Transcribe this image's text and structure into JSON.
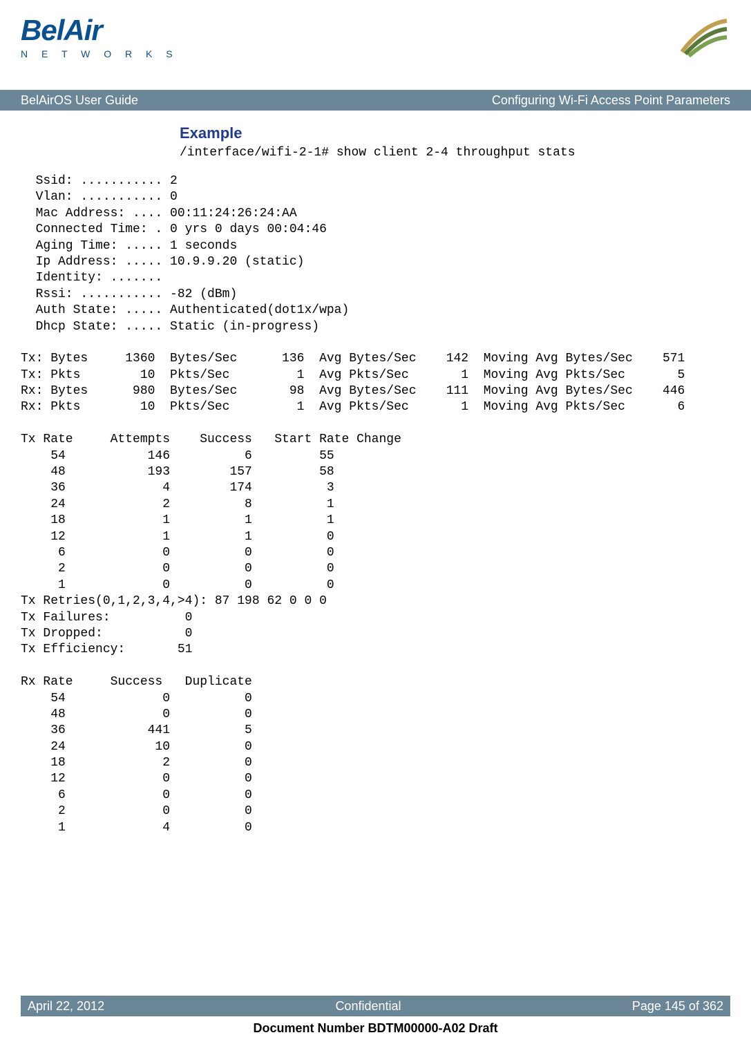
{
  "logo": {
    "brand": "BelAir",
    "subtext": "N E T W O R K S"
  },
  "titlebar": {
    "left": "BelAirOS User Guide",
    "right": "Configuring Wi-Fi Access Point Parameters"
  },
  "section": {
    "heading": "Example",
    "command": "/interface/wifi-2-1# show client 2-4 throughput stats"
  },
  "client_info": {
    "ssid": "2",
    "vlan": "0",
    "mac_address": "00:11:24:26:24:AA",
    "connected_time": "0 yrs 0 days 00:04:46",
    "aging_time": "1 seconds",
    "ip_address": "10.9.9.20 (static)",
    "identity": "",
    "rssi": "-82 (dBm)",
    "auth_state": "Authenticated(dot1x/wpa)",
    "dhcp_state": "Static (in-progress)"
  },
  "throughput": {
    "tx_bytes": {
      "total": "1360",
      "per_sec": "136",
      "avg_per_sec": "142",
      "moving_avg": "571"
    },
    "tx_pkts": {
      "total": "10",
      "per_sec": "1",
      "avg_per_sec": "1",
      "moving_avg": "5"
    },
    "rx_bytes": {
      "total": "980",
      "per_sec": "98",
      "avg_per_sec": "111",
      "moving_avg": "446"
    },
    "rx_pkts": {
      "total": "10",
      "per_sec": "1",
      "avg_per_sec": "1",
      "moving_avg": "6"
    }
  },
  "tx_rate_table": {
    "headers": [
      "Tx Rate",
      "Attempts",
      "Success",
      "Start Rate Change"
    ],
    "rows": [
      [
        "54",
        "146",
        "6",
        "55"
      ],
      [
        "48",
        "193",
        "157",
        "58"
      ],
      [
        "36",
        "4",
        "174",
        "3"
      ],
      [
        "24",
        "2",
        "8",
        "1"
      ],
      [
        "18",
        "1",
        "1",
        "1"
      ],
      [
        "12",
        "1",
        "1",
        "0"
      ],
      [
        "6",
        "0",
        "0",
        "0"
      ],
      [
        "2",
        "0",
        "0",
        "0"
      ],
      [
        "1",
        "0",
        "0",
        "0"
      ]
    ]
  },
  "tx_stats": {
    "retries_label": "Tx Retries(0,1,2,3,4,>4):",
    "retries": "87 198 62 0 0 0",
    "failures": "0",
    "dropped": "0",
    "efficiency": "51"
  },
  "rx_rate_table": {
    "headers": [
      "Rx Rate",
      "Success",
      "Duplicate"
    ],
    "rows": [
      [
        "54",
        "0",
        "0"
      ],
      [
        "48",
        "0",
        "0"
      ],
      [
        "36",
        "441",
        "5"
      ],
      [
        "24",
        "10",
        "0"
      ],
      [
        "18",
        "2",
        "0"
      ],
      [
        "12",
        "0",
        "0"
      ],
      [
        "6",
        "0",
        "0"
      ],
      [
        "2",
        "0",
        "0"
      ],
      [
        "1",
        "4",
        "0"
      ]
    ]
  },
  "footer": {
    "date": "April 22, 2012",
    "classification": "Confidential",
    "page": "Page 145 of 362",
    "docnum": "Document Number BDTM00000-A02 Draft"
  }
}
